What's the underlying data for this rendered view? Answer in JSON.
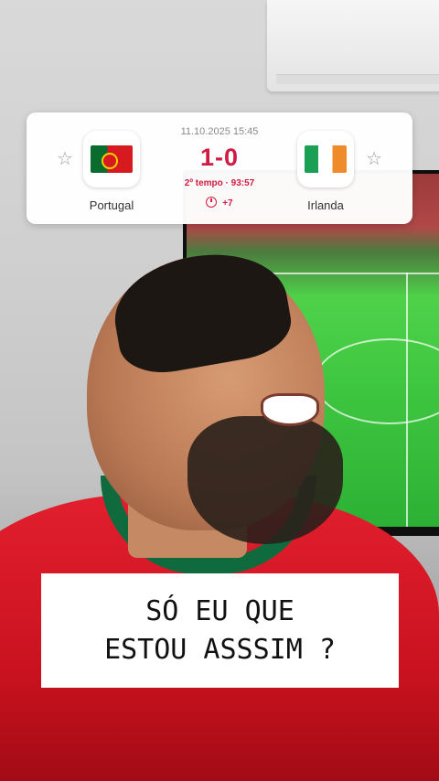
{
  "match": {
    "date": "11.10.2025 15:45",
    "home_team": "Portugal",
    "away_team": "Irlanda",
    "score": "1-0",
    "status": "2º tempo · 93:57",
    "added_time": "+7",
    "home_flag_icon": "portugal-flag-icon",
    "away_flag_icon": "ireland-flag-icon",
    "favorite_icon": "star-icon"
  },
  "caption": {
    "text": "SÓ EU QUE\nESTOU ASSSIM ?"
  },
  "colors": {
    "score_red": "#d01c43",
    "card_bg": "#ffffff",
    "jersey_red": "#e21f2e",
    "jersey_green": "#0f6b3e",
    "pitch_green": "#3fc640"
  }
}
